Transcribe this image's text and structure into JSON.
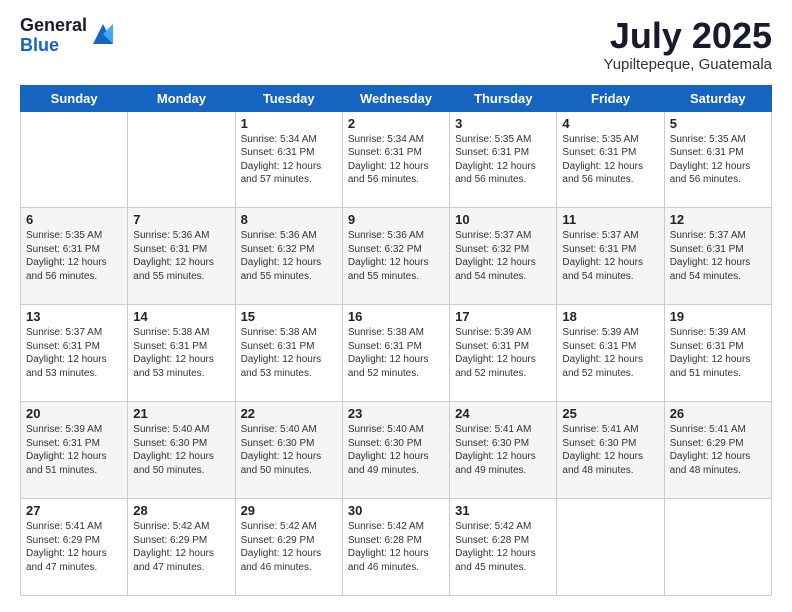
{
  "logo": {
    "general": "General",
    "blue": "Blue"
  },
  "header": {
    "month": "July 2025",
    "location": "Yupiltepeque, Guatemala"
  },
  "weekdays": [
    "Sunday",
    "Monday",
    "Tuesday",
    "Wednesday",
    "Thursday",
    "Friday",
    "Saturday"
  ],
  "weeks": [
    [
      null,
      null,
      {
        "day": "1",
        "sunrise": "Sunrise: 5:34 AM",
        "sunset": "Sunset: 6:31 PM",
        "daylight": "Daylight: 12 hours and 57 minutes."
      },
      {
        "day": "2",
        "sunrise": "Sunrise: 5:34 AM",
        "sunset": "Sunset: 6:31 PM",
        "daylight": "Daylight: 12 hours and 56 minutes."
      },
      {
        "day": "3",
        "sunrise": "Sunrise: 5:35 AM",
        "sunset": "Sunset: 6:31 PM",
        "daylight": "Daylight: 12 hours and 56 minutes."
      },
      {
        "day": "4",
        "sunrise": "Sunrise: 5:35 AM",
        "sunset": "Sunset: 6:31 PM",
        "daylight": "Daylight: 12 hours and 56 minutes."
      },
      {
        "day": "5",
        "sunrise": "Sunrise: 5:35 AM",
        "sunset": "Sunset: 6:31 PM",
        "daylight": "Daylight: 12 hours and 56 minutes."
      }
    ],
    [
      {
        "day": "6",
        "sunrise": "Sunrise: 5:35 AM",
        "sunset": "Sunset: 6:31 PM",
        "daylight": "Daylight: 12 hours and 56 minutes."
      },
      {
        "day": "7",
        "sunrise": "Sunrise: 5:36 AM",
        "sunset": "Sunset: 6:31 PM",
        "daylight": "Daylight: 12 hours and 55 minutes."
      },
      {
        "day": "8",
        "sunrise": "Sunrise: 5:36 AM",
        "sunset": "Sunset: 6:32 PM",
        "daylight": "Daylight: 12 hours and 55 minutes."
      },
      {
        "day": "9",
        "sunrise": "Sunrise: 5:36 AM",
        "sunset": "Sunset: 6:32 PM",
        "daylight": "Daylight: 12 hours and 55 minutes."
      },
      {
        "day": "10",
        "sunrise": "Sunrise: 5:37 AM",
        "sunset": "Sunset: 6:32 PM",
        "daylight": "Daylight: 12 hours and 54 minutes."
      },
      {
        "day": "11",
        "sunrise": "Sunrise: 5:37 AM",
        "sunset": "Sunset: 6:31 PM",
        "daylight": "Daylight: 12 hours and 54 minutes."
      },
      {
        "day": "12",
        "sunrise": "Sunrise: 5:37 AM",
        "sunset": "Sunset: 6:31 PM",
        "daylight": "Daylight: 12 hours and 54 minutes."
      }
    ],
    [
      {
        "day": "13",
        "sunrise": "Sunrise: 5:37 AM",
        "sunset": "Sunset: 6:31 PM",
        "daylight": "Daylight: 12 hours and 53 minutes."
      },
      {
        "day": "14",
        "sunrise": "Sunrise: 5:38 AM",
        "sunset": "Sunset: 6:31 PM",
        "daylight": "Daylight: 12 hours and 53 minutes."
      },
      {
        "day": "15",
        "sunrise": "Sunrise: 5:38 AM",
        "sunset": "Sunset: 6:31 PM",
        "daylight": "Daylight: 12 hours and 53 minutes."
      },
      {
        "day": "16",
        "sunrise": "Sunrise: 5:38 AM",
        "sunset": "Sunset: 6:31 PM",
        "daylight": "Daylight: 12 hours and 52 minutes."
      },
      {
        "day": "17",
        "sunrise": "Sunrise: 5:39 AM",
        "sunset": "Sunset: 6:31 PM",
        "daylight": "Daylight: 12 hours and 52 minutes."
      },
      {
        "day": "18",
        "sunrise": "Sunrise: 5:39 AM",
        "sunset": "Sunset: 6:31 PM",
        "daylight": "Daylight: 12 hours and 52 minutes."
      },
      {
        "day": "19",
        "sunrise": "Sunrise: 5:39 AM",
        "sunset": "Sunset: 6:31 PM",
        "daylight": "Daylight: 12 hours and 51 minutes."
      }
    ],
    [
      {
        "day": "20",
        "sunrise": "Sunrise: 5:39 AM",
        "sunset": "Sunset: 6:31 PM",
        "daylight": "Daylight: 12 hours and 51 minutes."
      },
      {
        "day": "21",
        "sunrise": "Sunrise: 5:40 AM",
        "sunset": "Sunset: 6:30 PM",
        "daylight": "Daylight: 12 hours and 50 minutes."
      },
      {
        "day": "22",
        "sunrise": "Sunrise: 5:40 AM",
        "sunset": "Sunset: 6:30 PM",
        "daylight": "Daylight: 12 hours and 50 minutes."
      },
      {
        "day": "23",
        "sunrise": "Sunrise: 5:40 AM",
        "sunset": "Sunset: 6:30 PM",
        "daylight": "Daylight: 12 hours and 49 minutes."
      },
      {
        "day": "24",
        "sunrise": "Sunrise: 5:41 AM",
        "sunset": "Sunset: 6:30 PM",
        "daylight": "Daylight: 12 hours and 49 minutes."
      },
      {
        "day": "25",
        "sunrise": "Sunrise: 5:41 AM",
        "sunset": "Sunset: 6:30 PM",
        "daylight": "Daylight: 12 hours and 48 minutes."
      },
      {
        "day": "26",
        "sunrise": "Sunrise: 5:41 AM",
        "sunset": "Sunset: 6:29 PM",
        "daylight": "Daylight: 12 hours and 48 minutes."
      }
    ],
    [
      {
        "day": "27",
        "sunrise": "Sunrise: 5:41 AM",
        "sunset": "Sunset: 6:29 PM",
        "daylight": "Daylight: 12 hours and 47 minutes."
      },
      {
        "day": "28",
        "sunrise": "Sunrise: 5:42 AM",
        "sunset": "Sunset: 6:29 PM",
        "daylight": "Daylight: 12 hours and 47 minutes."
      },
      {
        "day": "29",
        "sunrise": "Sunrise: 5:42 AM",
        "sunset": "Sunset: 6:29 PM",
        "daylight": "Daylight: 12 hours and 46 minutes."
      },
      {
        "day": "30",
        "sunrise": "Sunrise: 5:42 AM",
        "sunset": "Sunset: 6:28 PM",
        "daylight": "Daylight: 12 hours and 46 minutes."
      },
      {
        "day": "31",
        "sunrise": "Sunrise: 5:42 AM",
        "sunset": "Sunset: 6:28 PM",
        "daylight": "Daylight: 12 hours and 45 minutes."
      },
      null,
      null
    ]
  ]
}
